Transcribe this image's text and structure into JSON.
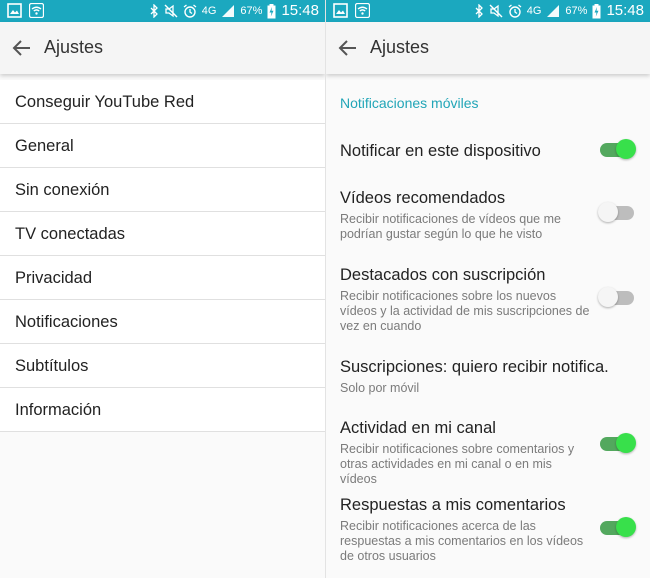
{
  "status_bar": {
    "battery": "67%",
    "network": "4G",
    "time": "15:48"
  },
  "left_screen": {
    "title": "Ajustes",
    "items": [
      {
        "label": "Conseguir YouTube Red"
      },
      {
        "label": "General"
      },
      {
        "label": "Sin conexión"
      },
      {
        "label": "TV conectadas"
      },
      {
        "label": "Privacidad"
      },
      {
        "label": "Notificaciones"
      },
      {
        "label": "Subtítulos"
      },
      {
        "label": "Información"
      }
    ]
  },
  "right_screen": {
    "title": "Ajustes",
    "section": "Notificaciones móviles",
    "settings": [
      {
        "title": "Notificar en este dispositivo",
        "subtitle": "",
        "toggle": true
      },
      {
        "title": "Vídeos recomendados",
        "subtitle": "Recibir notificaciones de vídeos que me podrían gustar según lo que he visto",
        "toggle": false
      },
      {
        "title": "Destacados con suscripción",
        "subtitle": "Recibir notificaciones sobre los nuevos vídeos y la actividad de mis suscripciones de vez en cuando",
        "toggle": false
      },
      {
        "title": "Suscripciones: quiero recibir notifica.",
        "subtitle": "Solo por móvil",
        "toggle": null
      },
      {
        "title": "Actividad en mi canal",
        "subtitle": "Recibir notificaciones sobre comentarios y otras actividades en mi canal o en mis vídeos",
        "toggle": true
      },
      {
        "title": "Respuestas a mis comentarios",
        "subtitle": "Recibir notificaciones acerca de las respuestas a mis comentarios en los vídeos de otros usuarios",
        "toggle": true
      }
    ]
  },
  "icons": {
    "back": "arrow-back-icon",
    "gallery": "gallery-icon",
    "wifi": "wifi-icon",
    "bluetooth": "bluetooth-icon",
    "mute": "mute-icon",
    "alarm": "alarm-icon",
    "signal": "signal-icon",
    "battery": "battery-charging-icon"
  },
  "colors": {
    "status_bar": "#1ba8bf",
    "accent": "#21a5b7",
    "toggle_on_knob": "#38e04b",
    "toggle_on_track": "#53a85e",
    "toggle_off_track": "#bdbdbd"
  }
}
